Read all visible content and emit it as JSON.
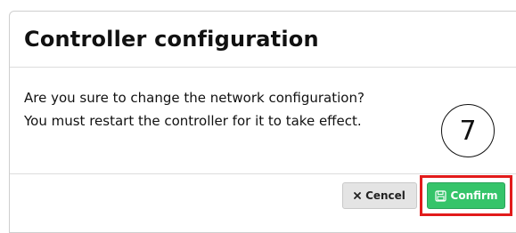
{
  "dialog": {
    "title": "Controller configuration",
    "message_line1": "Are you sure to change the network configuration?",
    "message_line2": "You must restart the controller for it to take effect."
  },
  "buttons": {
    "cancel_label": "Cencel",
    "confirm_label": "Confirm",
    "cancel_icon": "close-icon",
    "confirm_icon": "floppy-disk-icon"
  },
  "annotation": {
    "step_number": "7",
    "highlight_color": "#e21b1b"
  },
  "colors": {
    "confirm_green": "#35c46a",
    "cancel_gray": "#e4e4e4"
  }
}
